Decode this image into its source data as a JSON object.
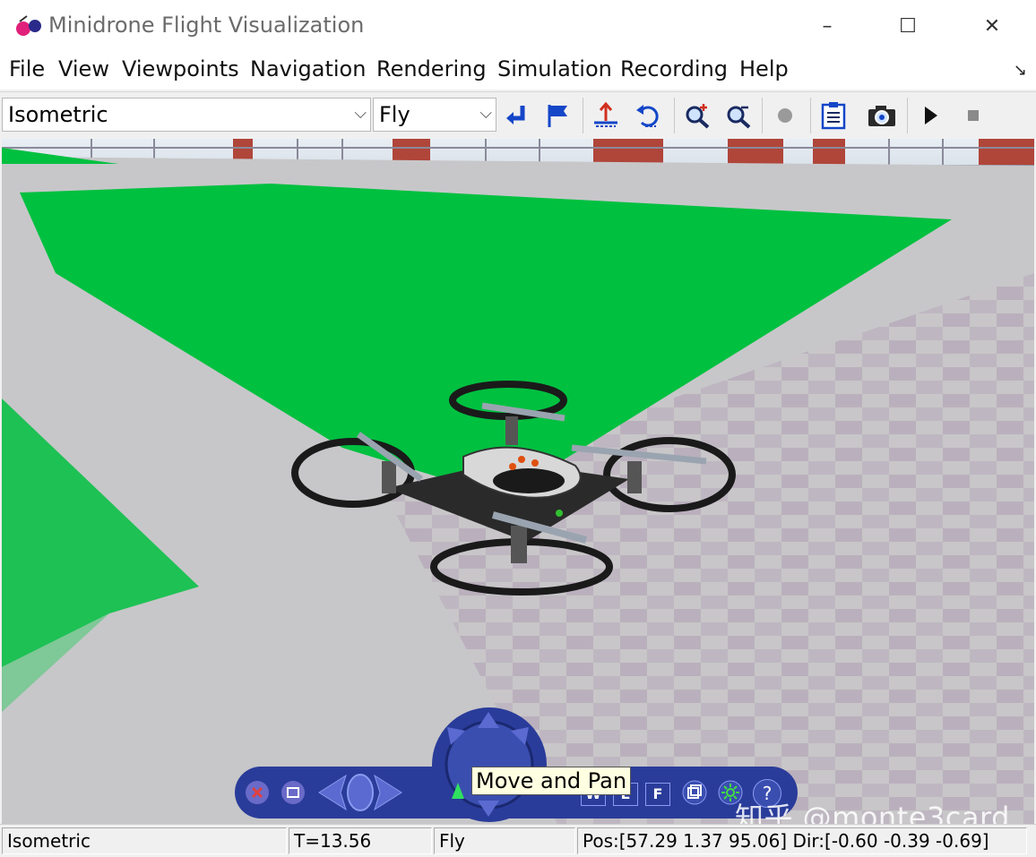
{
  "window": {
    "title": "Minidrone Flight Visualization",
    "app_icon": "vrml-viewer-icon",
    "controls": {
      "minimize": "–",
      "maximize": "☐",
      "close": "✕"
    }
  },
  "menubar": {
    "items": [
      "File",
      "View",
      "Viewpoints",
      "Navigation",
      "Rendering",
      "Simulation",
      "Recording",
      "Help"
    ],
    "corner": "↘"
  },
  "toolbar": {
    "viewpoint_select": "Isometric",
    "navigation_select": "Fly",
    "buttons": [
      "return-to-viewpoint-icon",
      "create-viewpoint-flag-icon",
      "straighten-up-icon",
      "undo-move-icon",
      "zoom-in-icon",
      "zoom-out-icon",
      "record-icon",
      "clipboard-icon",
      "camera-capture-icon",
      "play-icon",
      "stop-icon"
    ]
  },
  "scene": {
    "colors": {
      "grass": "#00c040",
      "floor": "#c6c6c6",
      "brick": "#b0453a",
      "panel": "#2a3c9a"
    }
  },
  "navpanel": {
    "tooltip": "Move and Pan",
    "letters": {
      "w": "W",
      "e": "E",
      "f": "F"
    },
    "help": "?"
  },
  "watermark": "知乎 @monte3card",
  "statusbar": {
    "viewpoint": "Isometric",
    "time": "T=13.56",
    "mode": "Fly",
    "position": "Pos:[57.29 1.37 95.06] Dir:[-0.60 -0.39 -0.69]"
  }
}
